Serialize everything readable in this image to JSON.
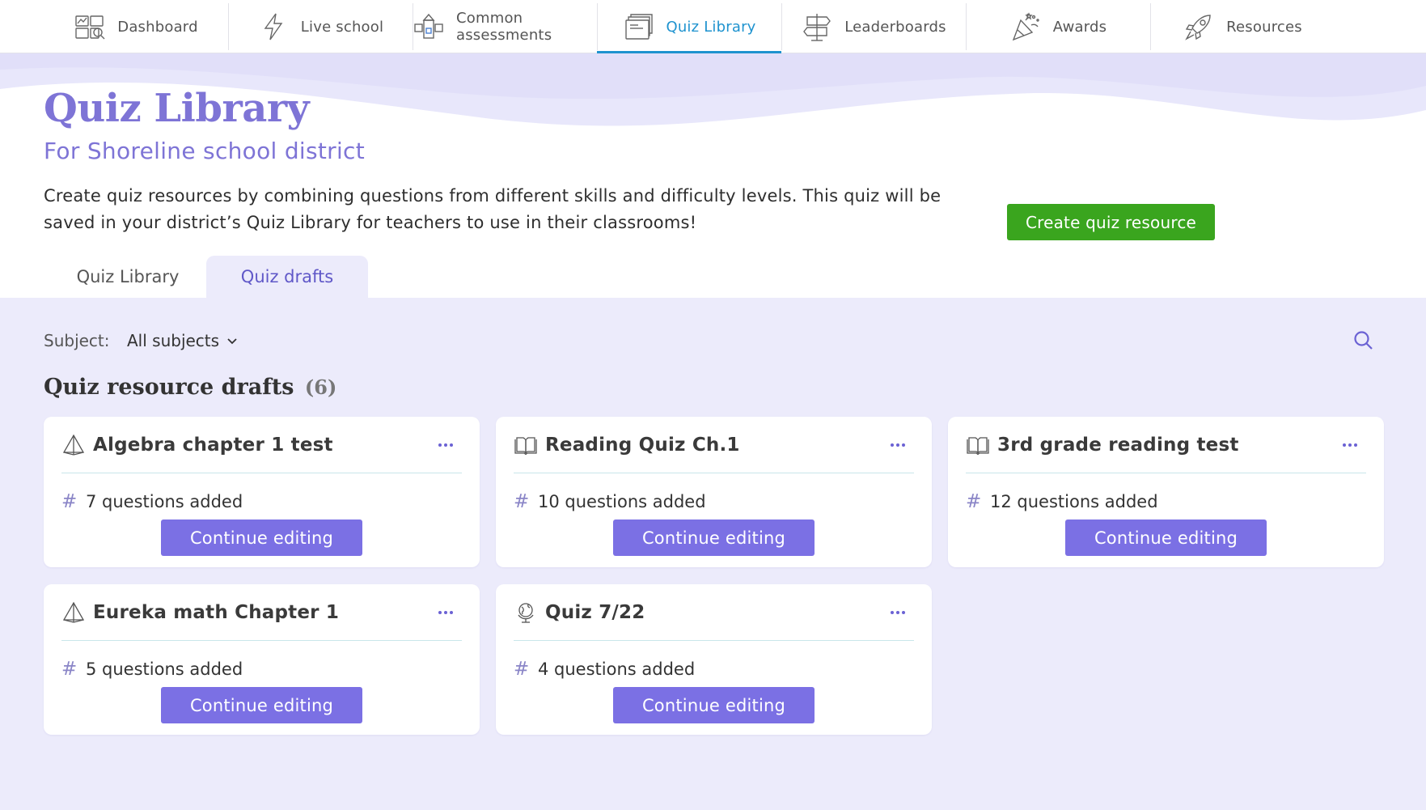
{
  "nav": {
    "items": [
      {
        "label": "Dashboard",
        "icon": "dashboard-icon"
      },
      {
        "label": "Live school",
        "icon": "lightning-icon"
      },
      {
        "label": "Common assessments",
        "icon": "assessments-icon"
      },
      {
        "label": "Quiz Library",
        "icon": "quiz-library-icon"
      },
      {
        "label": "Leaderboards",
        "icon": "leaderboard-icon"
      },
      {
        "label": "Awards",
        "icon": "party-popper-icon"
      },
      {
        "label": "Resources",
        "icon": "rocket-icon"
      }
    ],
    "active": "Quiz Library",
    "active_color": "#1f93cf"
  },
  "header": {
    "title": "Quiz Library",
    "subtitle": "For Shoreline school district",
    "description": "Create quiz resources by combining questions from different skills and difficulty levels. This quiz will be saved in your district’s Quiz Library for teachers to use in their classrooms!",
    "create_button": "Create quiz resource",
    "create_button_color": "#3aa51e",
    "accent_color": "#7e74d6"
  },
  "tabs": [
    {
      "label": "Quiz Library",
      "active": false
    },
    {
      "label": "Quiz drafts",
      "active": true
    }
  ],
  "filter": {
    "label": "Subject:",
    "selected": "All subjects",
    "search_icon": "search-icon"
  },
  "section": {
    "heading": "Quiz resource drafts",
    "count": "(6)"
  },
  "drafts": [
    {
      "title": "Algebra chapter 1 test",
      "icon": "geometry-icon",
      "count": "7 questions added",
      "button": "Continue editing"
    },
    {
      "title": "Reading Quiz Ch.1",
      "icon": "book-icon",
      "count": "10 questions added",
      "button": "Continue editing"
    },
    {
      "title": "3rd grade reading test",
      "icon": "book-icon",
      "count": "12 questions added",
      "button": "Continue editing"
    },
    {
      "title": "Eureka math Chapter 1",
      "icon": "geometry-icon",
      "count": "5 questions added",
      "button": "Continue editing"
    },
    {
      "title": "Quiz 7/22",
      "icon": "globe-icon",
      "count": "4 questions added",
      "button": "Continue editing"
    }
  ],
  "card_button_color": "#7b70e4"
}
